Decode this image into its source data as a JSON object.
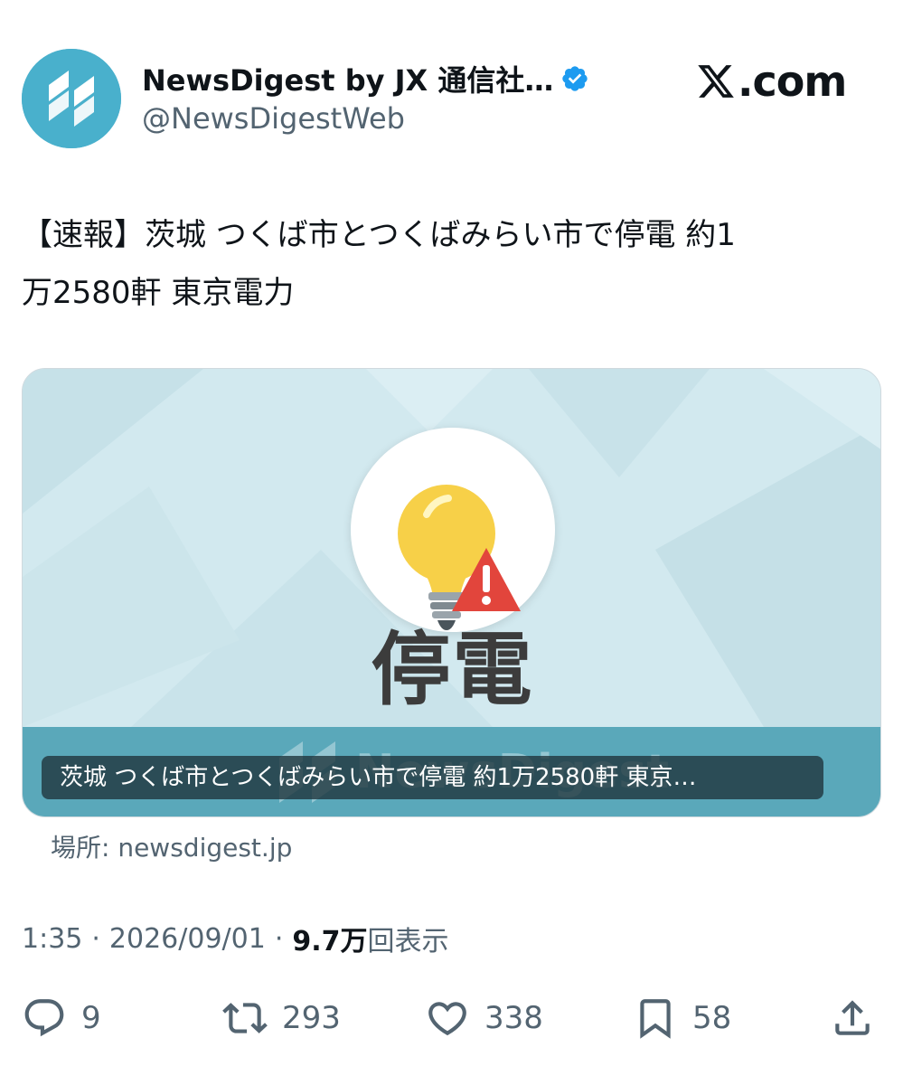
{
  "author": {
    "display_name": "NewsDigest by JX 通信社…",
    "handle": "@NewsDigestWeb",
    "verified": true,
    "avatar_color": "#49b0cc"
  },
  "site": {
    "label": ".com"
  },
  "tweet": {
    "text_line1": "【速報】茨城 つくば市とつくばみらい市で停電 約1",
    "text_line2": "万2580軒 東京電力"
  },
  "card": {
    "headline": "停電",
    "watermark": "NewsDigest",
    "title": "茨城 つくば市とつくばみらい市で停電 約1万2580軒 東京…",
    "source": "場所: newsdigest.jp",
    "bg_color": "#d2e9ef",
    "band_color": "#5aa8ba"
  },
  "meta": {
    "time": "1:35",
    "date": "2026/09/01",
    "views_count": "9.7万",
    "views_label": "回表示"
  },
  "actions": {
    "reply_count": "9",
    "retweet_count": "293",
    "like_count": "338",
    "bookmark_count": "58"
  },
  "colors": {
    "accent": "#1d9bf0",
    "muted": "#536471",
    "text": "#0f1419"
  }
}
